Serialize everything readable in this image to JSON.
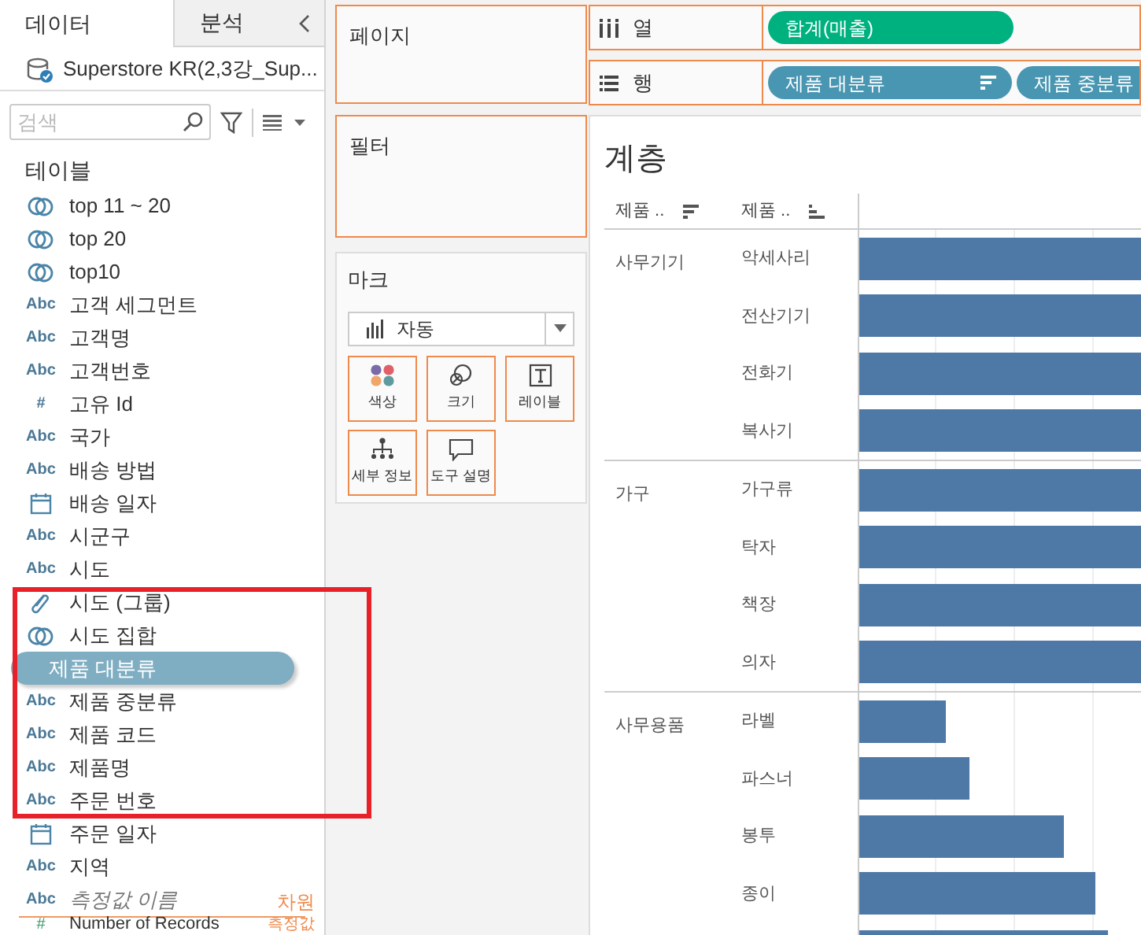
{
  "sidebar": {
    "tabs": [
      {
        "label": "데이터",
        "selected": true
      },
      {
        "label": "분석",
        "selected": false
      }
    ],
    "datasource": "Superstore KR(2,3강_Sup...",
    "search": {
      "placeholder": "검색"
    },
    "section": "테이블",
    "fields": [
      {
        "kind": "set",
        "label": "top 11 ~ 20"
      },
      {
        "kind": "set",
        "label": "top 20"
      },
      {
        "kind": "set",
        "label": "top10"
      },
      {
        "kind": "abc",
        "type_text": "Abc",
        "label": "고객 세그먼트"
      },
      {
        "kind": "abc",
        "type_text": "Abc",
        "label": "고객명"
      },
      {
        "kind": "abc",
        "type_text": "Abc",
        "label": "고객번호"
      },
      {
        "kind": "number",
        "type_text": "#",
        "label": "고유 Id"
      },
      {
        "kind": "abc",
        "type_text": "Abc",
        "label": "국가"
      },
      {
        "kind": "abc",
        "type_text": "Abc",
        "label": "배송 방법"
      },
      {
        "kind": "date",
        "label": "배송 일자"
      },
      {
        "kind": "abc",
        "type_text": "Abc",
        "label": "시군구"
      },
      {
        "kind": "abc",
        "type_text": "Abc",
        "label": "시도"
      },
      {
        "kind": "group",
        "label": "시도 (그룹)"
      },
      {
        "kind": "set",
        "label": "시도 집합"
      },
      {
        "kind": "dragging",
        "label": "제품 대분류"
      },
      {
        "kind": "abc",
        "type_text": "Abc",
        "label": "제품 중분류"
      },
      {
        "kind": "abc",
        "type_text": "Abc",
        "label": "제품 코드"
      },
      {
        "kind": "abc",
        "type_text": "Abc",
        "label": "제품명"
      },
      {
        "kind": "abc",
        "type_text": "Abc",
        "label": "주문 번호"
      },
      {
        "kind": "date",
        "label": "주문 일자"
      },
      {
        "kind": "abc",
        "type_text": "Abc",
        "label": "지역"
      }
    ],
    "measure_names": {
      "type_text": "Abc",
      "label": "측정값 이름",
      "tag": "차원"
    },
    "measures": [
      {
        "type_text": "#",
        "label": "Number of Records",
        "tag": "측정값"
      }
    ]
  },
  "pages": {
    "title": "페이지"
  },
  "filters": {
    "title": "필터"
  },
  "marks": {
    "title": "마크",
    "mark_type": "자동",
    "buttons": [
      {
        "kind": "color",
        "label": "색상"
      },
      {
        "kind": "size",
        "label": "크기"
      },
      {
        "kind": "label",
        "label": "레이블"
      },
      {
        "kind": "detail",
        "label": "세부 정보"
      },
      {
        "kind": "tooltip",
        "label": "도구 설명"
      }
    ]
  },
  "shelves": [
    {
      "kind": "columns",
      "label": "열",
      "pills": [
        {
          "kind": "measure",
          "label": "합계(매출)"
        }
      ]
    },
    {
      "kind": "rows",
      "label": "행",
      "pills": [
        {
          "kind": "dimension",
          "label": "제품 대분류",
          "sorted": true
        },
        {
          "kind": "dimension",
          "label": "제품 중분류"
        }
      ]
    }
  ],
  "view": {
    "title": "계층",
    "headers": [
      {
        "label": "제품 ..",
        "sort_descending": true
      },
      {
        "label": "제품 ..",
        "sort_descending": false
      }
    ],
    "groups": [
      {
        "label": "사무기기",
        "items": [
          "악세사리",
          "전산기기",
          "전화기",
          "복사기"
        ]
      },
      {
        "label": "가구",
        "items": [
          "가구류",
          "탁자",
          "책장",
          "의자"
        ]
      },
      {
        "label": "사무용품",
        "items": [
          "라벨",
          "파스너",
          "봉투",
          "종이"
        ]
      }
    ]
  }
}
